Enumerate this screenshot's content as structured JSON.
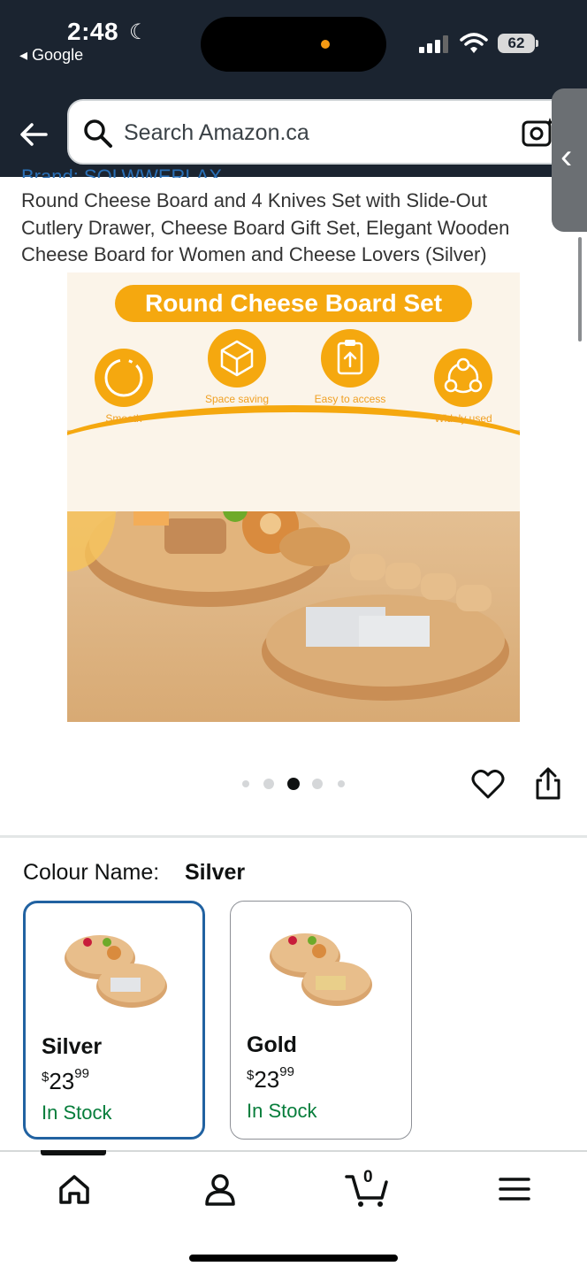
{
  "status_bar": {
    "time": "2:48",
    "back_app": "Google",
    "battery": "62"
  },
  "search": {
    "placeholder": "Search Amazon.ca"
  },
  "product": {
    "brand_partial": "Brand: SOLWWERLAX",
    "title": "Round Cheese Board and 4 Knives Set with Slide-Out Cutlery Drawer, Cheese Board Gift Set, Elegant Wooden Cheese Board for Women and Cheese Lovers (Silver)",
    "image": {
      "banner": "Round Cheese Board Set",
      "features": [
        {
          "label": "Smooth",
          "icon": "smooth-icon"
        },
        {
          "label": "Space saving",
          "icon": "cube-icon"
        },
        {
          "label": "Easy to access",
          "icon": "clipboard-icon"
        },
        {
          "label": "Widely used",
          "icon": "network-icon"
        }
      ]
    },
    "carousel": {
      "total": 5,
      "active_index": 2
    }
  },
  "colour": {
    "label": "Colour Name:",
    "selected": "Silver",
    "options": [
      {
        "name": "Silver",
        "currency": "$",
        "dollars": "23",
        "cents": "99",
        "stock": "In Stock",
        "selected": true
      },
      {
        "name": "Gold",
        "currency": "$",
        "dollars": "23",
        "cents": "99",
        "stock": "In Stock",
        "selected": false
      }
    ]
  },
  "bottom_nav": {
    "cart_count": "0",
    "items": [
      "home-icon",
      "account-icon",
      "cart-icon",
      "menu-icon"
    ]
  },
  "colors": {
    "header_bg": "#1b2430",
    "accent_orange": "#f5a80f",
    "selected_border": "#2162a1",
    "in_stock_green": "#067d3b"
  }
}
